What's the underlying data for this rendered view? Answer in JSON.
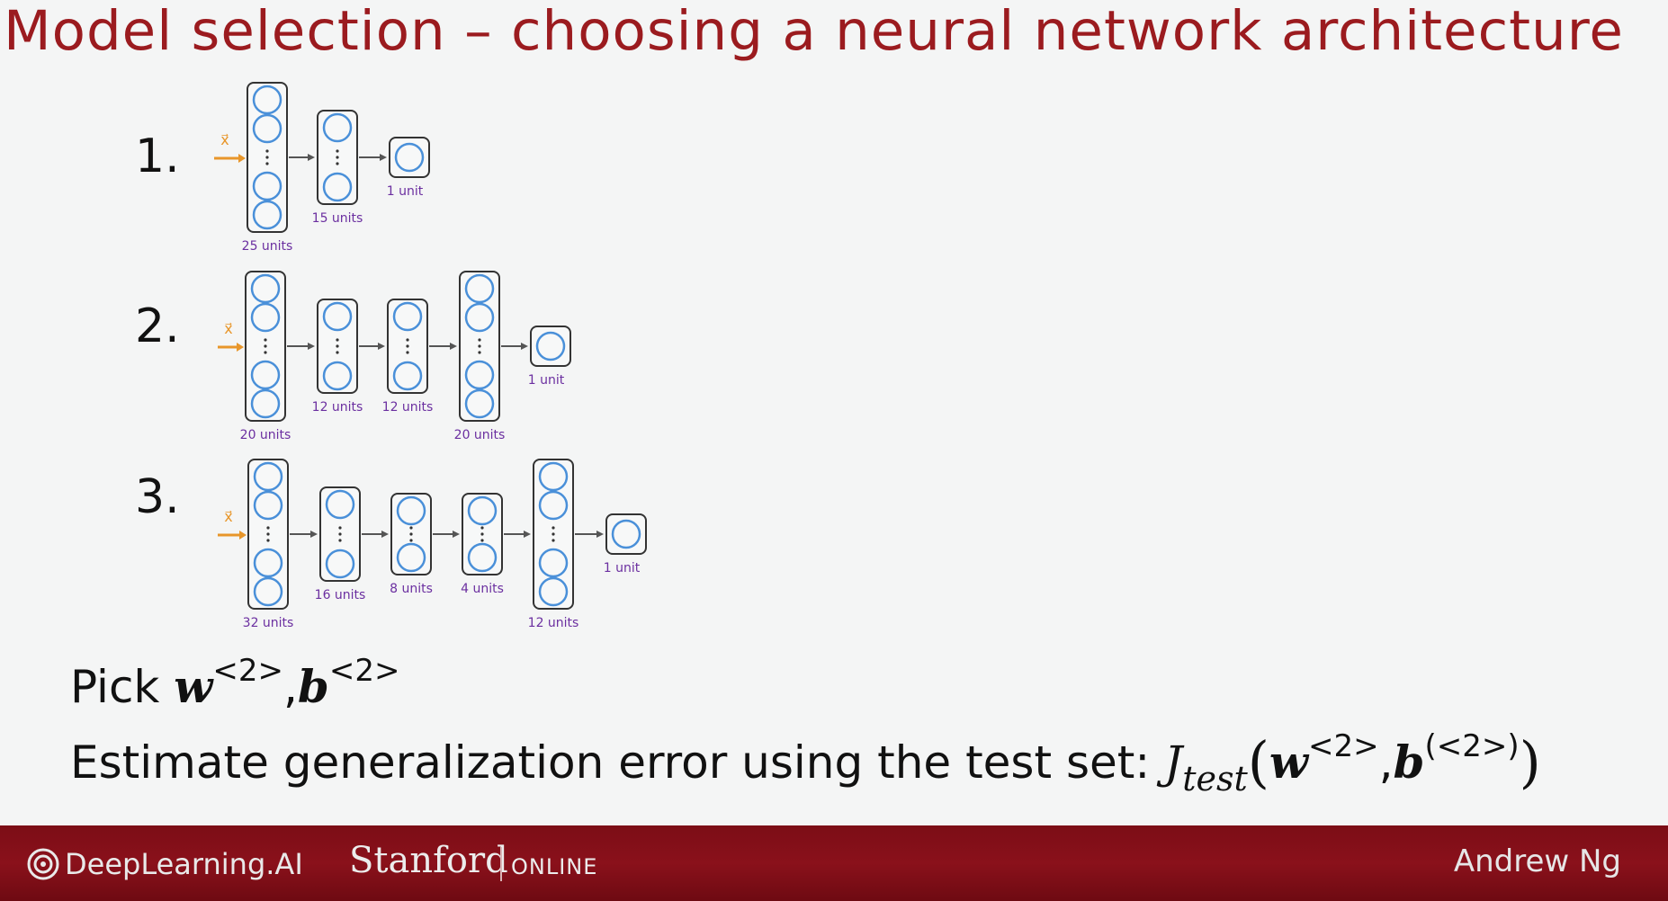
{
  "slide": {
    "title": "Model selection – choosing a neural network architecture",
    "colors": {
      "title": "#9b1b1f",
      "unit_label": "#6b2fa0",
      "node": "#4a90d9",
      "input_arrow": "#e8962a",
      "footer_bg": "#7c0d16"
    }
  },
  "networks": [
    {
      "number": "1.",
      "input_label": "x⃗",
      "layers": [
        {
          "units": 25,
          "label": "25 units"
        },
        {
          "units": 15,
          "label": "15 units"
        },
        {
          "units": 1,
          "label": "1 unit"
        }
      ]
    },
    {
      "number": "2.",
      "input_label": "x⃗",
      "layers": [
        {
          "units": 20,
          "label": "20 units"
        },
        {
          "units": 12,
          "label": "12 units"
        },
        {
          "units": 12,
          "label": "12 units"
        },
        {
          "units": 20,
          "label": "20 units"
        },
        {
          "units": 1,
          "label": "1 unit"
        }
      ]
    },
    {
      "number": "3.",
      "input_label": "x⃗",
      "layers": [
        {
          "units": 32,
          "label": "32 units"
        },
        {
          "units": 16,
          "label": "16 units"
        },
        {
          "units": 8,
          "label": "8 units"
        },
        {
          "units": 4,
          "label": "4 units"
        },
        {
          "units": 12,
          "label": "12 units"
        },
        {
          "units": 1,
          "label": "1 unit"
        }
      ]
    }
  ],
  "pick_line": {
    "text": "Pick ",
    "w": "w",
    "w_sup": "<2>",
    "comma": ",",
    "b": "b",
    "b_sup": "<2>"
  },
  "estimate_line": {
    "text": "Estimate generalization error using the test set: ",
    "J": "J",
    "J_sub": "test",
    "open_paren": "(",
    "w": "w",
    "w_sup": "<2>",
    "comma": ",",
    "b": "b",
    "b_sup": "(<2>)",
    "close_paren": ")"
  },
  "footer": {
    "deeplearning": "DeepLearning.AI",
    "stanford": "Stanford",
    "online": "ONLINE",
    "author": "Andrew Ng"
  }
}
